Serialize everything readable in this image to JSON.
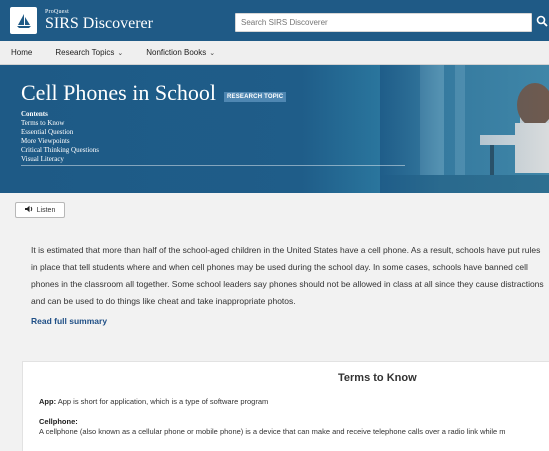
{
  "header": {
    "logo_small": "ProQuest",
    "logo_big": "SIRS Discoverer",
    "search_placeholder": "Search SIRS Discoverer"
  },
  "nav": {
    "items": [
      "Home",
      "Research Topics",
      "Nonfiction Books"
    ]
  },
  "banner": {
    "title": "Cell Phones in School",
    "badge": "RESEARCH TOPIC",
    "contents_heading": "Contents",
    "contents": [
      "Terms to Know",
      "Essential Question",
      "More Viewpoints",
      "Critical Thinking Questions",
      "Visual Literacy"
    ]
  },
  "listen_label": "Listen",
  "summary": {
    "text": "It is estimated that more than half of the school-aged children in the United States have a cell phone. As a result, schools have put rules in place that tell students where and when cell phones may be used during the school day. In some cases, schools have banned cell phones in the classroom all together. Some school leaders say phones should not be allowed in class at all since they cause distractions and can be used to do things like cheat and take inappropriate photos.",
    "read_more": "Read full summary"
  },
  "terms": {
    "title": "Terms to Know",
    "app_term": "App:",
    "app_def": "App is short for application, which is a type of software program",
    "cell_term": "Cellphone:",
    "cell_def": "A cellphone (also known as a cellular phone or mobile phone) is a device that can make and receive telephone calls over a radio link while m"
  }
}
